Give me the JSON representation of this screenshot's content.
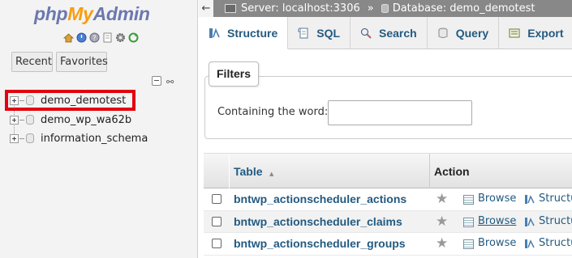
{
  "sidebar": {
    "logo": {
      "part1": "php",
      "part2": "My",
      "part3": "Admin"
    },
    "recent_label": "Recent",
    "favorites_label": "Favorites",
    "databases": [
      {
        "name": "demo_demotest",
        "highlighted": true
      },
      {
        "name": "demo_wp_wa62b",
        "highlighted": false
      },
      {
        "name": "information_schema",
        "highlighted": false
      }
    ],
    "highlight_color": "#e3000f"
  },
  "breadcrumb": {
    "back_glyph": "←",
    "server": "Server: localhost:3306",
    "separator": "»",
    "database": "Database: demo_demotest"
  },
  "tabs": [
    {
      "label": "Structure",
      "active": true
    },
    {
      "label": "SQL",
      "active": false
    },
    {
      "label": "Search",
      "active": false
    },
    {
      "label": "Query",
      "active": false
    },
    {
      "label": "Export",
      "active": false
    }
  ],
  "filters": {
    "legend": "Filters",
    "label": "Containing the word:",
    "value": ""
  },
  "table": {
    "header_table": "Table",
    "header_action": "Action",
    "rows": [
      {
        "name": "bntwp_actionscheduler_actions",
        "browse": "Browse",
        "structure": "Structure"
      },
      {
        "name": "bntwp_actionscheduler_claims",
        "browse": "Browse",
        "structure": "Structure"
      },
      {
        "name": "bntwp_actionscheduler_groups",
        "browse": "Browse",
        "structure": "Structure"
      }
    ]
  },
  "colors": {
    "link": "#235a81",
    "topbar": "#888888",
    "logo_blue": "#6c78af",
    "logo_orange": "#f89c0e"
  }
}
